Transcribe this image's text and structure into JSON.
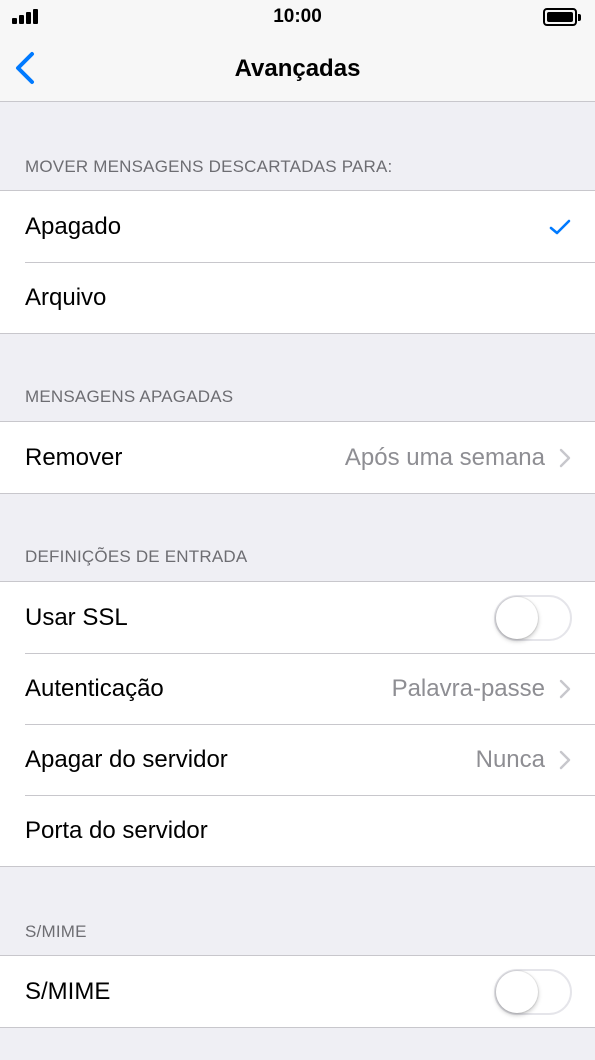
{
  "status_bar": {
    "time": "10:00"
  },
  "nav": {
    "title": "Avançadas"
  },
  "sections": [
    {
      "header": "MOVER MENSAGENS DESCARTADAS PARA:",
      "rows": [
        {
          "label": "Apagado",
          "checked": true
        },
        {
          "label": "Arquivo",
          "checked": false
        }
      ]
    },
    {
      "header": "MENSAGENS APAGADAS",
      "rows": [
        {
          "label": "Remover",
          "value": "Após uma semana"
        }
      ]
    },
    {
      "header": "DEFINIÇÕES DE ENTRADA",
      "rows": [
        {
          "label": "Usar SSL",
          "toggle": false
        },
        {
          "label": "Autenticação",
          "value": "Palavra-passe"
        },
        {
          "label": "Apagar do servidor",
          "value": "Nunca"
        },
        {
          "label": "Porta do servidor"
        }
      ]
    },
    {
      "header": "S/MIME",
      "rows": [
        {
          "label": "S/MIME",
          "toggle": false
        }
      ]
    }
  ],
  "colors": {
    "accent": "#007aff",
    "background": "#efeff4",
    "secondary_text": "#8e8e93"
  }
}
